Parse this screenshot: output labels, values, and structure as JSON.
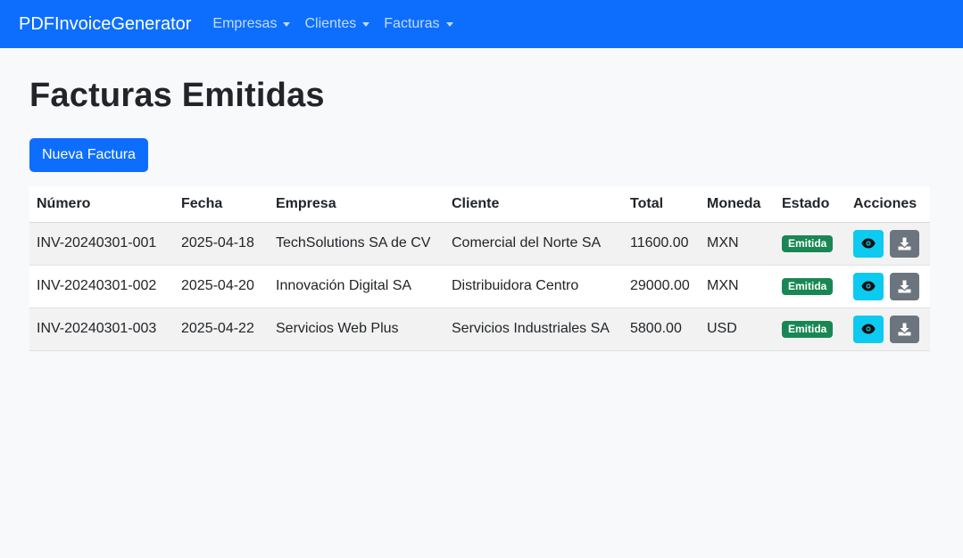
{
  "nav": {
    "brand": "PDFInvoiceGenerator",
    "items": [
      {
        "label": "Empresas"
      },
      {
        "label": "Clientes"
      },
      {
        "label": "Facturas"
      }
    ]
  },
  "page": {
    "title": "Facturas Emitidas",
    "new_button": "Nueva Factura"
  },
  "table": {
    "headers": [
      "Número",
      "Fecha",
      "Empresa",
      "Cliente",
      "Total",
      "Moneda",
      "Estado",
      "Acciones"
    ],
    "rows": [
      {
        "numero": "INV-20240301-001",
        "fecha": "2025-04-18",
        "empresa": "TechSolutions SA de CV",
        "cliente": "Comercial del Norte SA",
        "total": "11600.00",
        "moneda": "MXN",
        "estado": "Emitida"
      },
      {
        "numero": "INV-20240301-002",
        "fecha": "2025-04-20",
        "empresa": "Innovación Digital SA",
        "cliente": "Distribuidora Centro",
        "total": "29000.00",
        "moneda": "MXN",
        "estado": "Emitida"
      },
      {
        "numero": "INV-20240301-003",
        "fecha": "2025-04-22",
        "empresa": "Servicios Web Plus",
        "cliente": "Servicios Industriales SA",
        "total": "5800.00",
        "moneda": "USD",
        "estado": "Emitida"
      }
    ]
  },
  "icons": {
    "view": "eye-icon",
    "download": "download-icon"
  },
  "colors": {
    "navbar": "#0d6efd",
    "primary": "#0d6efd",
    "info": "#0dcaf0",
    "secondary": "#6c757d",
    "success": "#198754"
  }
}
